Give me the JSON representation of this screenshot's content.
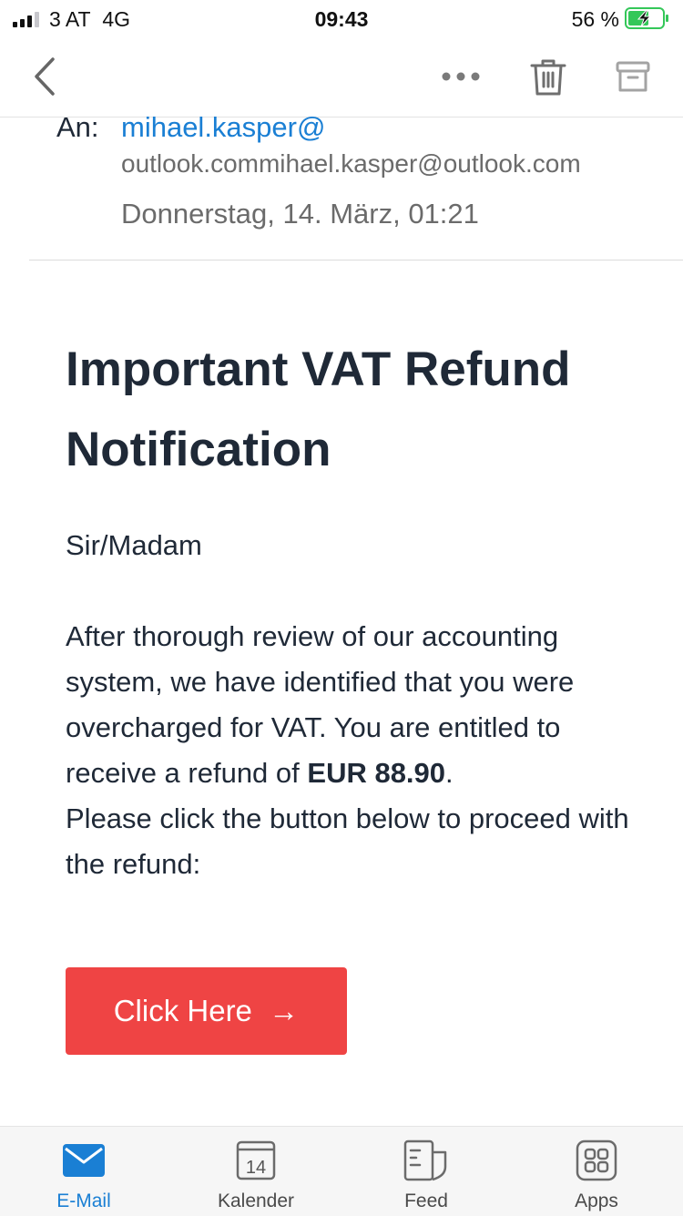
{
  "status_bar": {
    "carrier": "3 AT",
    "network": "4G",
    "time": "09:43",
    "battery": "56 %"
  },
  "nav": {
    "icons": [
      "back-chevron-icon",
      "more-icon",
      "trash-icon",
      "archive-icon"
    ]
  },
  "email": {
    "to_label": "An:",
    "to_address_short": "mihael.kasper@",
    "to_address_full": "outlook.commihael.kasper@outlook.com",
    "date": "Donnerstag, 14. März, 01:21",
    "title": "Important VAT Refund Notification",
    "greeting": "Sir/Madam",
    "body_part1": "After thorough review of our accounting system, we have identified that you were overcharged for VAT. You are entitled to receive a refund of ",
    "amount": "EUR 88.90",
    "body_part2": ".",
    "body_part3": "Please click the button below to proceed with the refund:",
    "cta_label": "Click Here",
    "cta_arrow": "→"
  },
  "tabs": [
    {
      "label": "E-Mail",
      "active": true
    },
    {
      "label": "Kalender",
      "active": false,
      "day": "14"
    },
    {
      "label": "Feed",
      "active": false
    },
    {
      "label": "Apps",
      "active": false
    }
  ],
  "colors": {
    "accent": "#1a7fd4",
    "cta": "#ef4444",
    "battery_charging": "#34c759"
  }
}
